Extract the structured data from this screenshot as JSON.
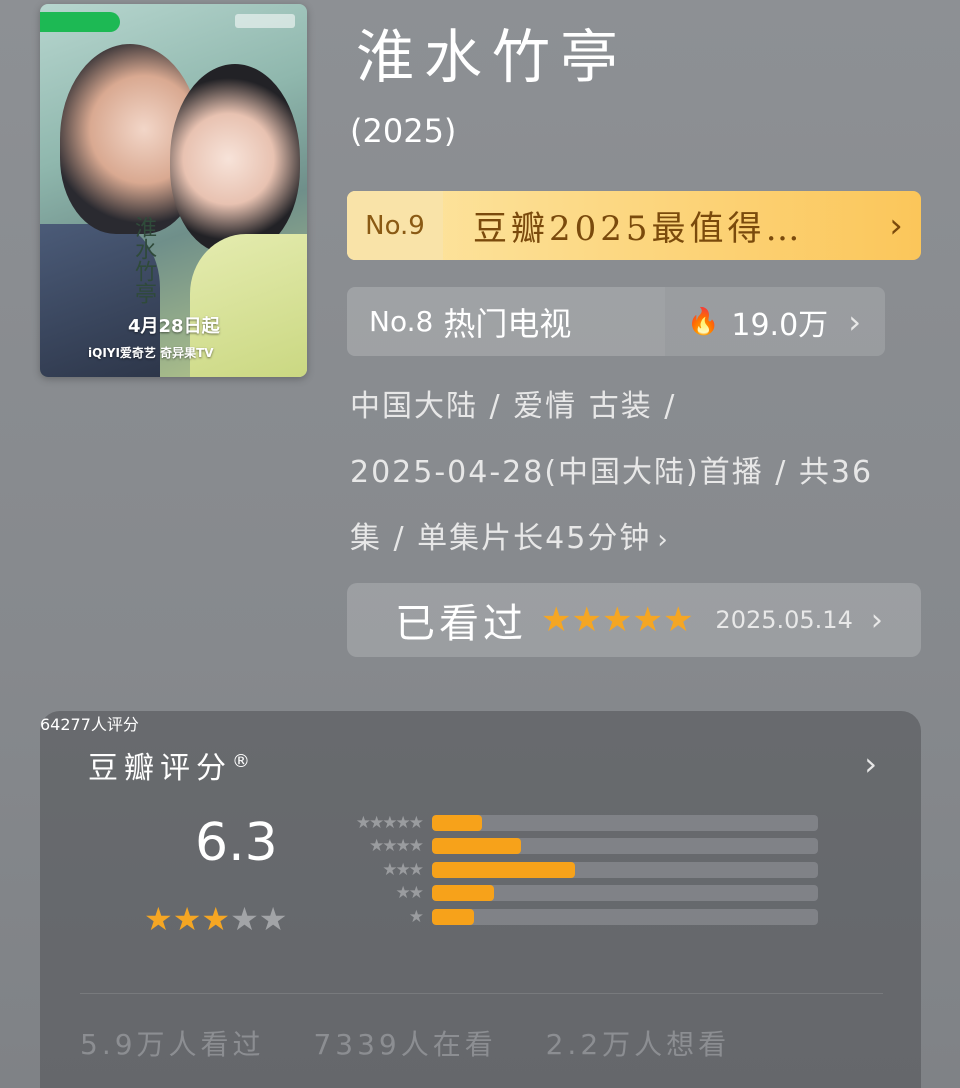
{
  "poster": {
    "calligraphy": "淮水竹亭",
    "date": "4月28日起",
    "logos": "iQIYI爱奇艺  奇异果TV"
  },
  "title": "淮水竹亭",
  "year": "(2025)",
  "rank_gold": {
    "number": "No.9",
    "text": "豆瓣2025最值得…",
    "chevron_icon": "chevron-right-icon"
  },
  "rank_hot": {
    "number": "No.8",
    "text": "热门电视",
    "flame_icon": "flame-icon",
    "count": "19.0万",
    "chevron_icon": "chevron-right-icon"
  },
  "info": {
    "line1": "中国大陆 / 爱情 古装 /",
    "line2": "2025-04-28(中国大陆)首播 / 共36",
    "line3": "集 / 单集片长45分钟"
  },
  "watched": {
    "label": "已看过",
    "stars": 5,
    "date": "2025.05.14"
  },
  "rating": {
    "title": "豆瓣评分",
    "registered": "®",
    "score": "6.3",
    "score_stars": 3,
    "score_stars_max": 5,
    "distribution": [
      {
        "stars": "★★★★★",
        "fraction": 0.13
      },
      {
        "stars": "★★★★",
        "fraction": 0.23
      },
      {
        "stars": "★★★",
        "fraction": 0.37
      },
      {
        "stars": "★★",
        "fraction": 0.16
      },
      {
        "stars": "★",
        "fraction": 0.11
      }
    ],
    "count": "64277人评分",
    "accent_color": "#f7a21a"
  },
  "stats": {
    "watched": "5.9万人看过",
    "watching": "7339人在看",
    "want": "2.2万人想看"
  }
}
